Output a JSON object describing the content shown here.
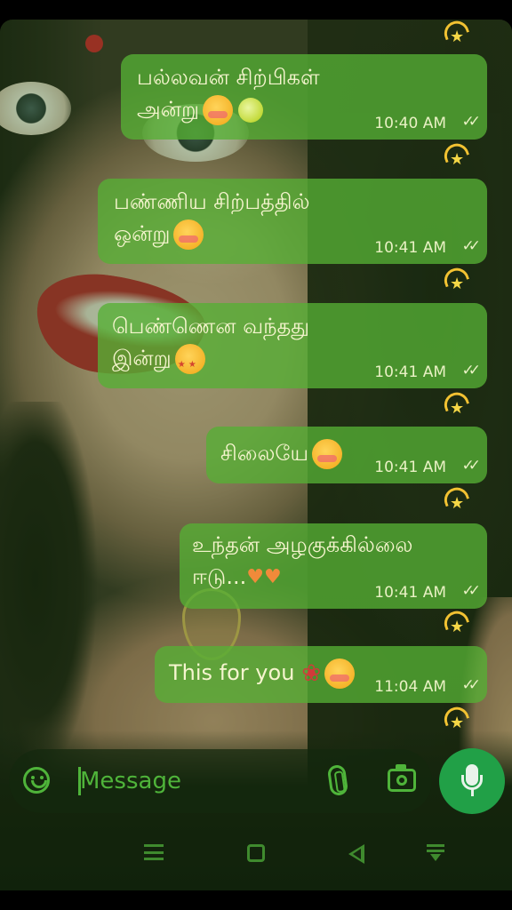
{
  "messages": [
    {
      "text": "பல்லவன் சிற்பிகள்\nஅன்று",
      "time": "10:40 AM",
      "ticks": "✓✓",
      "emoji": "blush-kiss-emoji"
    },
    {
      "text": "பண்ணிய சிற்பத்தில்\nஒன்று",
      "time": "10:41 AM",
      "ticks": "✓✓",
      "emoji": "smiling-hearts-emoji"
    },
    {
      "text": "பெண்ணென வந்தது\nஇன்று",
      "time": "10:41 AM",
      "ticks": "✓✓",
      "emoji": "star-struck-emoji"
    },
    {
      "text": "சிலையே",
      "time": "10:41 AM",
      "ticks": "✓✓",
      "emoji": "kiss-emoji"
    },
    {
      "text": "உந்தன் அழகுக்கில்லை\nஈடு...",
      "time": "10:41 AM",
      "ticks": "✓✓",
      "emoji": "hearts-emoji"
    },
    {
      "text": "This for you",
      "time": "11:04 AM",
      "ticks": "✓✓",
      "emoji": "rose-kiss-emoji"
    }
  ],
  "composer": {
    "placeholder": "Message",
    "emoji_icon": "smiley-icon",
    "attach_icon": "paperclip-icon",
    "camera_icon": "camera-icon",
    "mic_icon": "microphone-icon"
  },
  "colors": {
    "bubble": "#56b034",
    "accent": "#21a047",
    "icon": "#4fb43a",
    "reaction": "#f4d23a"
  },
  "navbar": {
    "icons": [
      "menu-icon",
      "home-icon",
      "back-icon",
      "notification-shade-icon"
    ]
  }
}
